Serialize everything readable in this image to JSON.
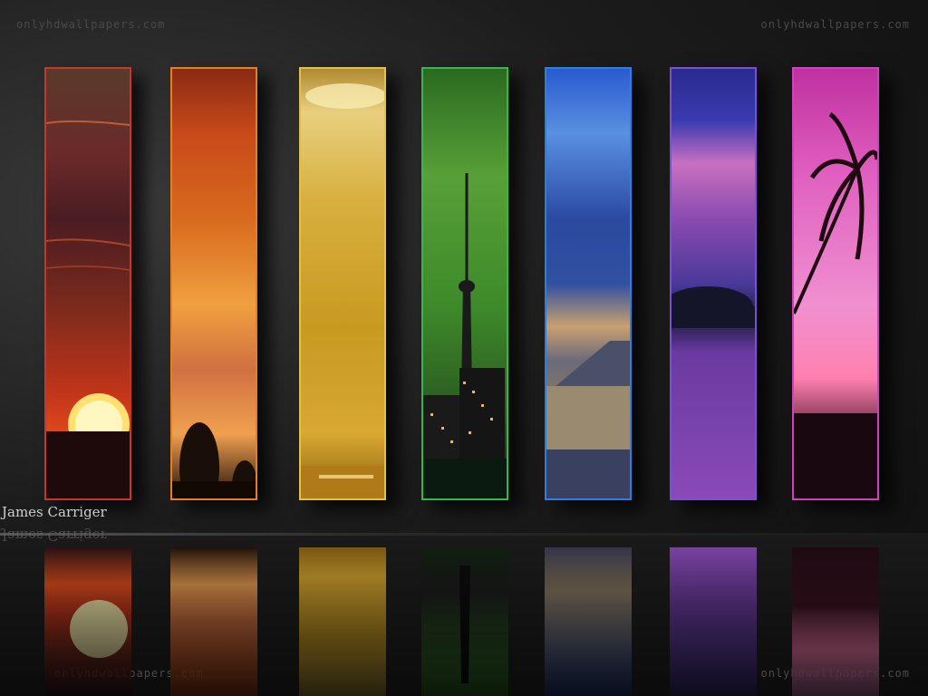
{
  "watermark": "onlyhdwallpapers.com",
  "credit": "James Carriger",
  "panels": [
    {
      "name": "red-sunset",
      "border": "#c0392b"
    },
    {
      "name": "orange-sky",
      "border": "#e67e22"
    },
    {
      "name": "yellow-sea",
      "border": "#e0c050"
    },
    {
      "name": "green-tower",
      "border": "#39b54a"
    },
    {
      "name": "blue-shore",
      "border": "#2e7de0"
    },
    {
      "name": "violet-lake",
      "border": "#7a4fd0"
    },
    {
      "name": "magenta-palm",
      "border": "#d040c0"
    }
  ]
}
